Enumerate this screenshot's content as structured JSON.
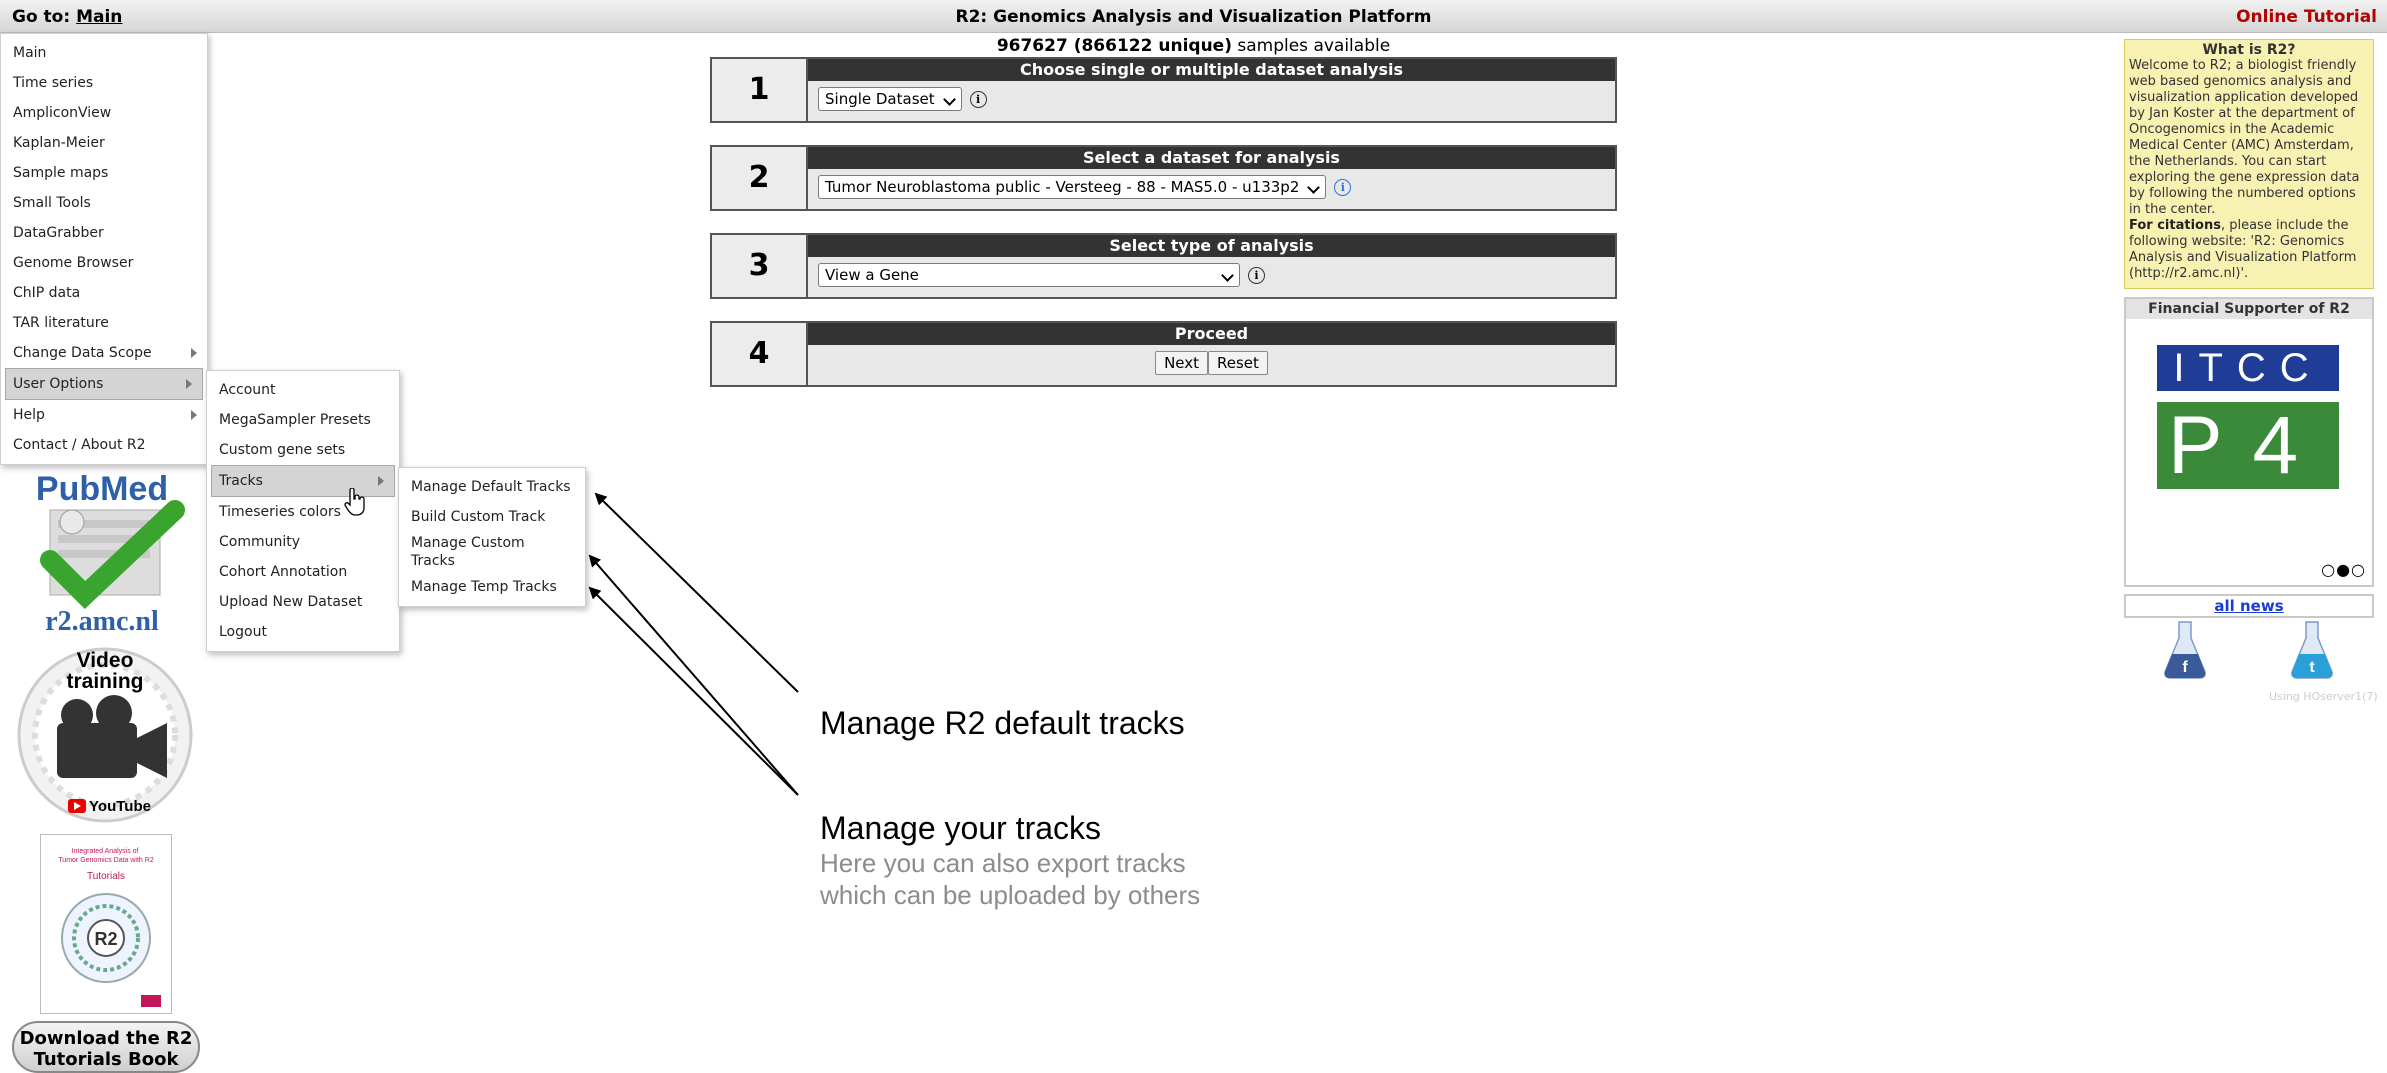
{
  "topbar": {
    "goto_label": "Go to:",
    "goto_link": "Main",
    "title": "R2: Genomics Analysis and Visualization Platform",
    "tutorial": "Online Tutorial"
  },
  "main_menu": {
    "items": [
      {
        "label": "Main"
      },
      {
        "label": "Time series"
      },
      {
        "label": "AmpliconView"
      },
      {
        "label": "Kaplan-Meier"
      },
      {
        "label": "Sample maps"
      },
      {
        "label": "Small Tools"
      },
      {
        "label": "DataGrabber"
      },
      {
        "label": "Genome Browser"
      },
      {
        "label": "ChIP data"
      },
      {
        "label": "TAR literature"
      },
      {
        "label": "Change Data Scope"
      },
      {
        "label": "User Options"
      },
      {
        "label": "Help"
      },
      {
        "label": "Contact / About R2"
      }
    ]
  },
  "user_menu": {
    "items": [
      {
        "label": "Account"
      },
      {
        "label": "MegaSampler Presets"
      },
      {
        "label": "Custom gene sets"
      },
      {
        "label": "Tracks"
      },
      {
        "label": "Timeseries colors"
      },
      {
        "label": "Community"
      },
      {
        "label": "Cohort Annotation"
      },
      {
        "label": "Upload New Dataset"
      },
      {
        "label": "Logout"
      }
    ]
  },
  "tracks_menu": {
    "items": [
      {
        "label": "Manage Default Tracks"
      },
      {
        "label": "Build Custom Track"
      },
      {
        "label": "Manage Custom Tracks"
      },
      {
        "label": "Manage Temp Tracks"
      }
    ]
  },
  "left": {
    "pubmed_text": "PubMed",
    "r2amc_text": "r2.amc.nl",
    "video_text_1": "Video",
    "video_text_2": "training",
    "youtube_text": "YouTube",
    "book_title": "Integrated Analysis of Tumor Genomics Data with R2",
    "book_sub": "Tutorials",
    "book_logo": "R2",
    "download_line1": "Download the R2",
    "download_line2": "Tutorials Book"
  },
  "samples": {
    "count": "967627 (866122 unique)",
    "suffix": "samples available"
  },
  "steps": [
    {
      "num": "1",
      "title": "Choose single or multiple dataset analysis",
      "value": "Single Dataset"
    },
    {
      "num": "2",
      "title": "Select a dataset for analysis",
      "value": "Tumor Neuroblastoma public - Versteeg - 88 - MAS5.0 - u133p2"
    },
    {
      "num": "3",
      "title": "Select type of analysis",
      "value": "View a Gene"
    },
    {
      "num": "4",
      "title": "Proceed",
      "next": "Next",
      "reset": "Reset"
    }
  ],
  "annotations": {
    "default_tracks": "Manage R2 default tracks",
    "your_tracks": "Manage your tracks",
    "export_line1": "Here you can also export tracks",
    "export_line2": "which can be uploaded by others"
  },
  "sidebar": {
    "whatis_title": "What is R2?",
    "whatis_text": "Welcome to R2; a biologist friendly web based genomics analysis and visualization application developed by Jan Koster at the department of Oncogenomics in the Academic Medical Center (AMC) Amsterdam, the Netherlands. You can start exploring the gene expression data by following the numbered options in the center.",
    "citation_bold": "For citations",
    "citation_text": ", please include the following website: 'R2: Genomics Analysis and Visualization Platform (http://r2.amc.nl)'.",
    "supporter_title": "Financial Supporter of R2",
    "itcc": "ITCC",
    "p4": "P4",
    "dots": "○●○",
    "all_news": "all news",
    "server": "Using HOserver1(7)"
  },
  "colors": {
    "step_header": "#333333",
    "tutorial": "#b30000",
    "whatis_bg": "#f7f1b2",
    "itcc_blue": "#1f3d97",
    "p4_green": "#3a8a3a"
  }
}
